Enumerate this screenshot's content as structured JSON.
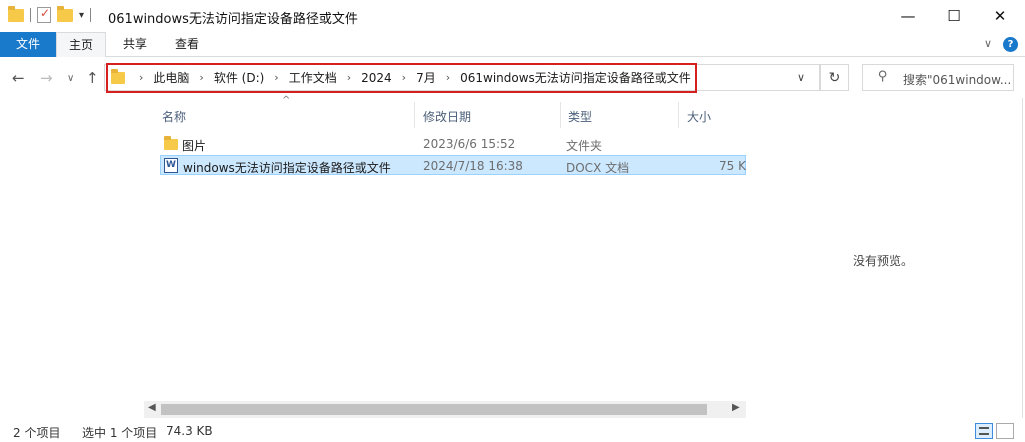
{
  "window": {
    "title": "061windows无法访问指定设备路径或文件",
    "minimize": "—",
    "maximize": "☐",
    "close": "✕"
  },
  "ribbon": {
    "tabs": [
      {
        "label": "文件"
      },
      {
        "label": "主页"
      },
      {
        "label": "共享"
      },
      {
        "label": "查看"
      }
    ],
    "help": "?"
  },
  "nav": {
    "back": "←",
    "forward": "→",
    "recent": "∨",
    "up": "↑",
    "breadcrumbs": [
      "此电脑",
      "软件 (D:)",
      "工作文档",
      "2024",
      "7月",
      "061windows无法访问指定设备路径或文件"
    ],
    "separator": "›",
    "dropdown": "∨",
    "refresh": "↻",
    "search_placeholder": "搜索\"061window..."
  },
  "columns": {
    "name": "名称",
    "modified": "修改日期",
    "type": "类型",
    "size": "大小"
  },
  "files": [
    {
      "name": "图片",
      "modified": "2023/6/6 15:52",
      "type": "文件夹",
      "size": "",
      "icon": "folder-icon"
    },
    {
      "name": "windows无法访问指定设备路径或文件",
      "modified": "2024/7/18 16:38",
      "type": "DOCX 文档",
      "size": "75 K",
      "icon": "docx-icon",
      "selected": true
    }
  ],
  "preview": {
    "empty_text": "没有预览。"
  },
  "status": {
    "item_count": "2 个项目",
    "selection": "选中 1 个项目",
    "selection_size": "74.3 KB"
  },
  "colors": {
    "accent": "#1979ca",
    "selection_bg": "#cce8ff",
    "highlight_border": "#d61f1f"
  }
}
